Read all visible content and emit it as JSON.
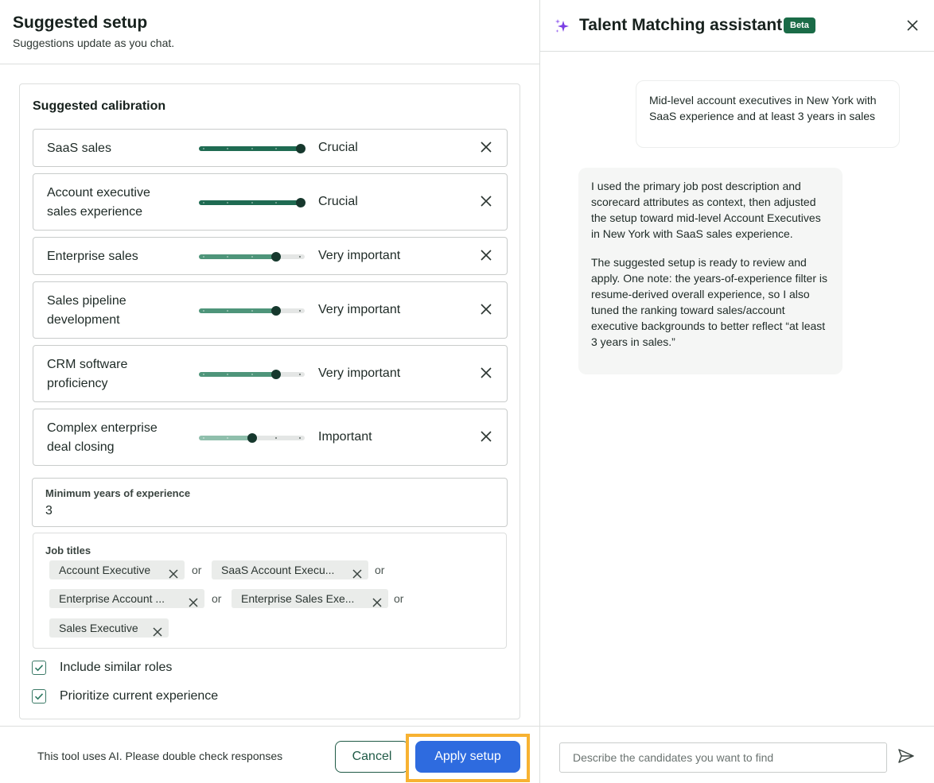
{
  "left_header": {
    "title": "Suggested setup",
    "subtitle": "Suggestions update as you chat."
  },
  "calibration": {
    "title": "Suggested calibration",
    "accent_color": "#1f6b52",
    "attributes": [
      {
        "name": "SaaS sales",
        "level": "Crucial",
        "value_fraction": 1.0
      },
      {
        "name": "Account executive sales experience",
        "level": "Crucial",
        "value_fraction": 1.0
      },
      {
        "name": "Enterprise sales",
        "level": "Very important",
        "value_fraction": 0.75
      },
      {
        "name": "Sales pipeline development",
        "level": "Very important",
        "value_fraction": 0.75
      },
      {
        "name": "CRM software proficiency",
        "level": "Very important",
        "value_fraction": 0.75
      },
      {
        "name": "Complex enterprise deal closing",
        "level": "Important",
        "value_fraction": 0.5
      }
    ]
  },
  "min_years": {
    "label": "Minimum years of experience",
    "value": "3"
  },
  "job_titles": {
    "label": "Job titles",
    "separator": "or",
    "items": [
      "Account Executive",
      "SaaS Account Execu...",
      "Enterprise Account ...",
      "Enterprise Sales Exe...",
      "Sales Executive"
    ]
  },
  "options": {
    "similar_roles": {
      "label": "Include similar roles",
      "checked": true
    },
    "current_experience": {
      "label": "Prioritize current experience",
      "checked": true
    }
  },
  "left_footer": {
    "disclaimer": "This tool uses AI. Please double check responses",
    "cancel_label": "Cancel",
    "apply_label": "Apply setup"
  },
  "assistant": {
    "title": "Talent Matching assistant",
    "badge": "Beta",
    "icon": "sparkle-icon",
    "user_message": "Mid-level account executives in New York with SaaS experience and at least 3 years in sales",
    "bot_message_p1": "I used the primary job post description and scorecard attributes as context, then adjusted the setup toward mid-level Account Executives in New York with SaaS sales experience.",
    "bot_message_p2": "The suggested setup is ready to review and apply. One note: the years-of-experience filter is resume-derived overall experience, so I also tuned the ranking toward sales/account executive backgrounds to better reflect “at least 3 years in sales.”",
    "input_placeholder": "Describe the candidates you want to find"
  }
}
